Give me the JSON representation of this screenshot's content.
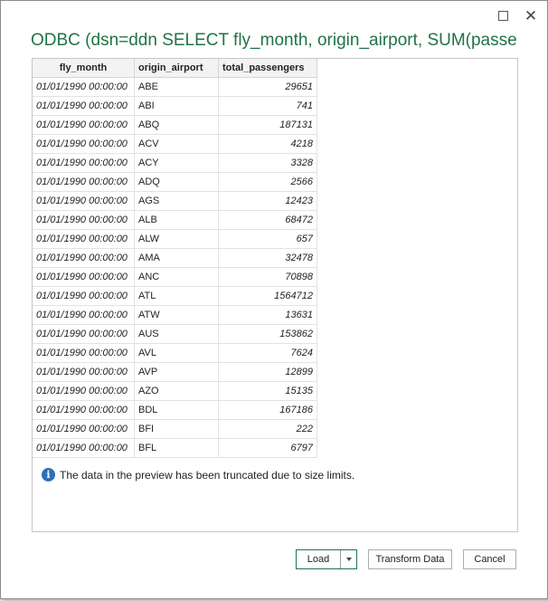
{
  "dialog": {
    "title": "ODBC (dsn=ddn SELECT fly_month, origin_airport, SUM(passe…"
  },
  "window_controls": {
    "maximize_icon": "maximize-icon",
    "close_icon": "close-icon",
    "close_glyph": "✕"
  },
  "table": {
    "columns": [
      "fly_month",
      "origin_airport",
      "total_passengers"
    ],
    "rows": [
      {
        "fly_month": "01/01/1990 00:00:00",
        "origin_airport": "ABE",
        "total_passengers": "29651"
      },
      {
        "fly_month": "01/01/1990 00:00:00",
        "origin_airport": "ABI",
        "total_passengers": "741"
      },
      {
        "fly_month": "01/01/1990 00:00:00",
        "origin_airport": "ABQ",
        "total_passengers": "187131"
      },
      {
        "fly_month": "01/01/1990 00:00:00",
        "origin_airport": "ACV",
        "total_passengers": "4218"
      },
      {
        "fly_month": "01/01/1990 00:00:00",
        "origin_airport": "ACY",
        "total_passengers": "3328"
      },
      {
        "fly_month": "01/01/1990 00:00:00",
        "origin_airport": "ADQ",
        "total_passengers": "2566"
      },
      {
        "fly_month": "01/01/1990 00:00:00",
        "origin_airport": "AGS",
        "total_passengers": "12423"
      },
      {
        "fly_month": "01/01/1990 00:00:00",
        "origin_airport": "ALB",
        "total_passengers": "68472"
      },
      {
        "fly_month": "01/01/1990 00:00:00",
        "origin_airport": "ALW",
        "total_passengers": "657"
      },
      {
        "fly_month": "01/01/1990 00:00:00",
        "origin_airport": "AMA",
        "total_passengers": "32478"
      },
      {
        "fly_month": "01/01/1990 00:00:00",
        "origin_airport": "ANC",
        "total_passengers": "70898"
      },
      {
        "fly_month": "01/01/1990 00:00:00",
        "origin_airport": "ATL",
        "total_passengers": "1564712"
      },
      {
        "fly_month": "01/01/1990 00:00:00",
        "origin_airport": "ATW",
        "total_passengers": "13631"
      },
      {
        "fly_month": "01/01/1990 00:00:00",
        "origin_airport": "AUS",
        "total_passengers": "153862"
      },
      {
        "fly_month": "01/01/1990 00:00:00",
        "origin_airport": "AVL",
        "total_passengers": "7624"
      },
      {
        "fly_month": "01/01/1990 00:00:00",
        "origin_airport": "AVP",
        "total_passengers": "12899"
      },
      {
        "fly_month": "01/01/1990 00:00:00",
        "origin_airport": "AZO",
        "total_passengers": "15135"
      },
      {
        "fly_month": "01/01/1990 00:00:00",
        "origin_airport": "BDL",
        "total_passengers": "167186"
      },
      {
        "fly_month": "01/01/1990 00:00:00",
        "origin_airport": "BFI",
        "total_passengers": "222"
      },
      {
        "fly_month": "01/01/1990 00:00:00",
        "origin_airport": "BFL",
        "total_passengers": "6797"
      }
    ]
  },
  "notice": {
    "icon": "info-icon",
    "icon_glyph": "i",
    "text": "The data in the preview has been truncated due to size limits."
  },
  "buttons": {
    "load": "Load",
    "load_dropdown_icon": "chevron-down-icon",
    "transform": "Transform Data",
    "cancel": "Cancel"
  },
  "colors": {
    "accent": "#217346",
    "info": "#2f6fb5"
  }
}
